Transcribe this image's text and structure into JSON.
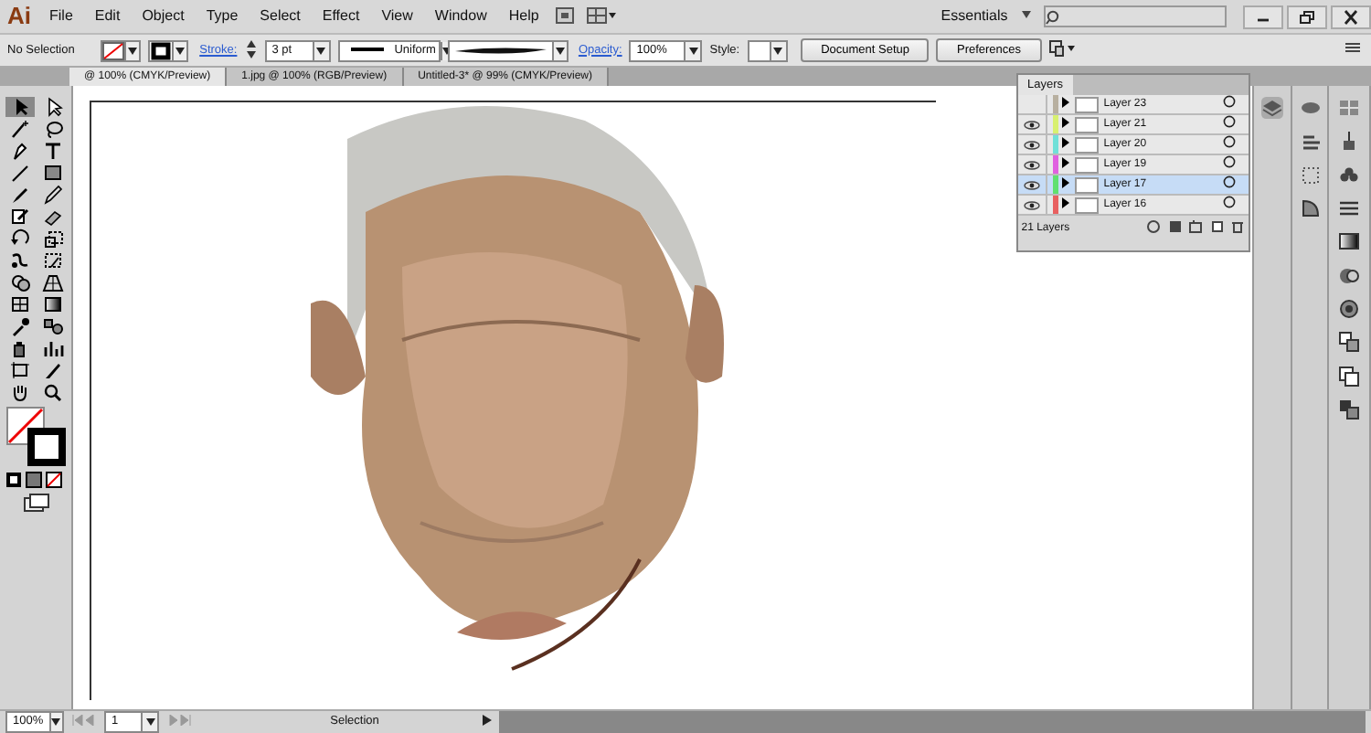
{
  "app_logo": "Ai",
  "menu": [
    "File",
    "Edit",
    "Object",
    "Type",
    "Select",
    "Effect",
    "View",
    "Window",
    "Help"
  ],
  "workspace": "Essentials",
  "control_bar": {
    "selection": "No Selection",
    "stroke_label": "Stroke:",
    "stroke_weight": "3 pt",
    "profile": "Uniform",
    "opacity_label": "Opacity:",
    "opacity": "100%",
    "style_label": "Style:",
    "buttons": [
      "Document Setup",
      "Preferences"
    ]
  },
  "tabs": [
    {
      "label": "@ 100% (CMYK/Preview)",
      "selected": true
    },
    {
      "label": "1.jpg @ 100% (RGB/Preview)",
      "selected": false
    },
    {
      "label": "Untitled-3* @ 99% (CMYK/Preview)",
      "selected": false
    }
  ],
  "tools": [
    {
      "kind": "arrow",
      "selected": true
    },
    {
      "kind": "direct",
      "selected": false
    },
    {
      "kind": "wand",
      "selected": false
    },
    {
      "kind": "lasso",
      "selected": false
    },
    {
      "kind": "pen",
      "selected": false
    },
    {
      "kind": "type",
      "selected": false
    },
    {
      "kind": "line",
      "selected": false
    },
    {
      "kind": "rect",
      "selected": false
    },
    {
      "kind": "brush",
      "selected": false
    },
    {
      "kind": "pencil",
      "selected": false
    },
    {
      "kind": "blob",
      "selected": false
    },
    {
      "kind": "eraser",
      "selected": false
    },
    {
      "kind": "rotate",
      "selected": false
    },
    {
      "kind": "scale",
      "selected": false
    },
    {
      "kind": "warp",
      "selected": false
    },
    {
      "kind": "transform",
      "selected": false
    },
    {
      "kind": "shape",
      "selected": false
    },
    {
      "kind": "perspective",
      "selected": false
    },
    {
      "kind": "mesh",
      "selected": false
    },
    {
      "kind": "gradient",
      "selected": false
    },
    {
      "kind": "dropper",
      "selected": false
    },
    {
      "kind": "blend",
      "selected": false
    },
    {
      "kind": "spray",
      "selected": false
    },
    {
      "kind": "graph",
      "selected": false
    },
    {
      "kind": "artboard",
      "selected": false
    },
    {
      "kind": "knife",
      "selected": false
    },
    {
      "kind": "hand",
      "selected": false
    },
    {
      "kind": "zoom",
      "selected": false
    }
  ],
  "layers_panel": {
    "title": "Layers",
    "footer": "21 Layers",
    "layers": [
      {
        "name": "Layer 23",
        "visible": false,
        "color": "#b8b0a0",
        "selected": false
      },
      {
        "name": "Layer 21",
        "visible": true,
        "color": "#d8f070",
        "selected": false
      },
      {
        "name": "Layer 20",
        "visible": true,
        "color": "#70e0d8",
        "selected": false
      },
      {
        "name": "Layer 19",
        "visible": true,
        "color": "#e060e0",
        "selected": false
      },
      {
        "name": "Layer 17",
        "visible": true,
        "color": "#60e070",
        "selected": true
      },
      {
        "name": "Layer 16",
        "visible": true,
        "color": "#e86060",
        "selected": false
      }
    ]
  },
  "status_bar": {
    "zoom": "100%",
    "artboard": "1",
    "tool": "Selection"
  }
}
